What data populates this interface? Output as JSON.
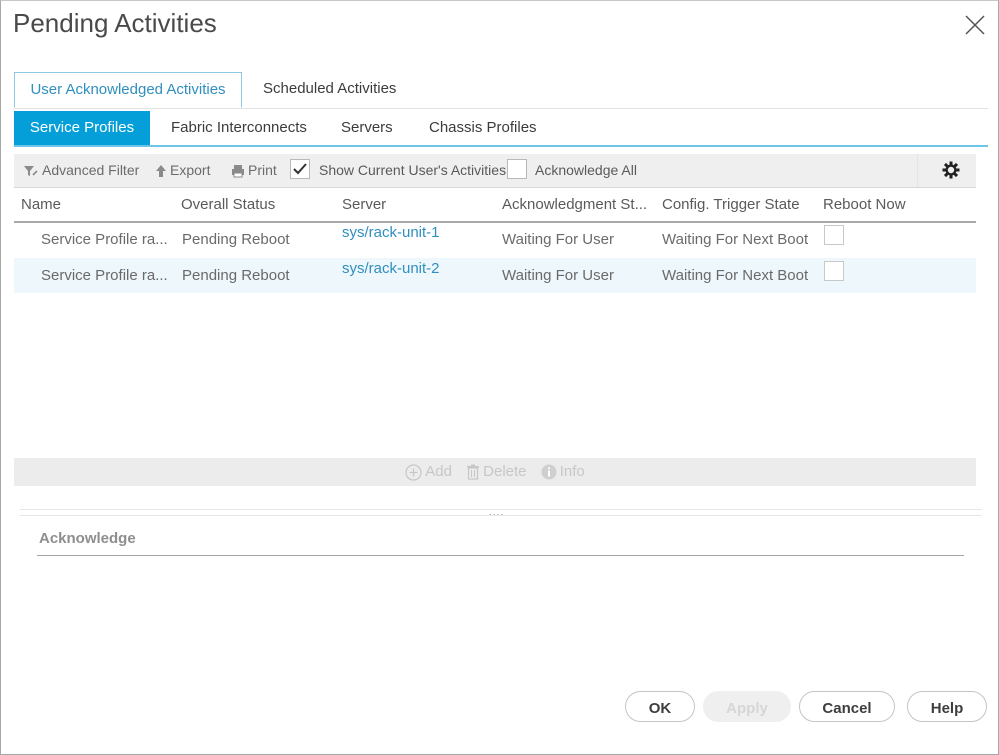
{
  "dialog": {
    "title": "Pending Activities",
    "close_icon": "close-icon"
  },
  "outer_tabs": [
    {
      "label": "User Acknowledged Activities",
      "active": true
    },
    {
      "label": "Scheduled Activities",
      "active": false
    }
  ],
  "inner_tabs": [
    {
      "label": "Service Profiles",
      "active": true
    },
    {
      "label": "Fabric Interconnects",
      "active": false
    },
    {
      "label": "Servers",
      "active": false
    },
    {
      "label": "Chassis Profiles",
      "active": false
    }
  ],
  "toolbar": {
    "advanced_filter": "Advanced Filter",
    "export": "Export",
    "print": "Print",
    "show_current_user": {
      "label": "Show Current User's Activities",
      "checked": true
    },
    "acknowledge_all": {
      "label": "Acknowledge All",
      "checked": false
    },
    "settings_icon": "gear-icon"
  },
  "table": {
    "columns": [
      "Name",
      "Overall Status",
      "Server",
      "Acknowledgment St...",
      "Config. Trigger State",
      "Reboot Now"
    ],
    "rows": [
      {
        "name": "Service Profile ra...",
        "overall_status": "Pending Reboot",
        "server": "sys/rack-unit-1",
        "ack_state": "Waiting For User",
        "config_trigger": "Waiting For Next Boot",
        "reboot_now": false
      },
      {
        "name": "Service Profile ra...",
        "overall_status": "Pending Reboot",
        "server": "sys/rack-unit-2",
        "ack_state": "Waiting For User",
        "config_trigger": "Waiting For Next Boot",
        "reboot_now": false
      }
    ]
  },
  "actions": {
    "add": "Add",
    "delete": "Delete",
    "info": "Info"
  },
  "splitter": "....",
  "acknowledge_section": {
    "label": "Acknowledge"
  },
  "footer": {
    "ok": "OK",
    "apply": "Apply",
    "cancel": "Cancel",
    "help": "Help"
  },
  "colors": {
    "accent": "#049fd9",
    "link": "#2f8fbf",
    "row_alt": "#eef7fb"
  }
}
